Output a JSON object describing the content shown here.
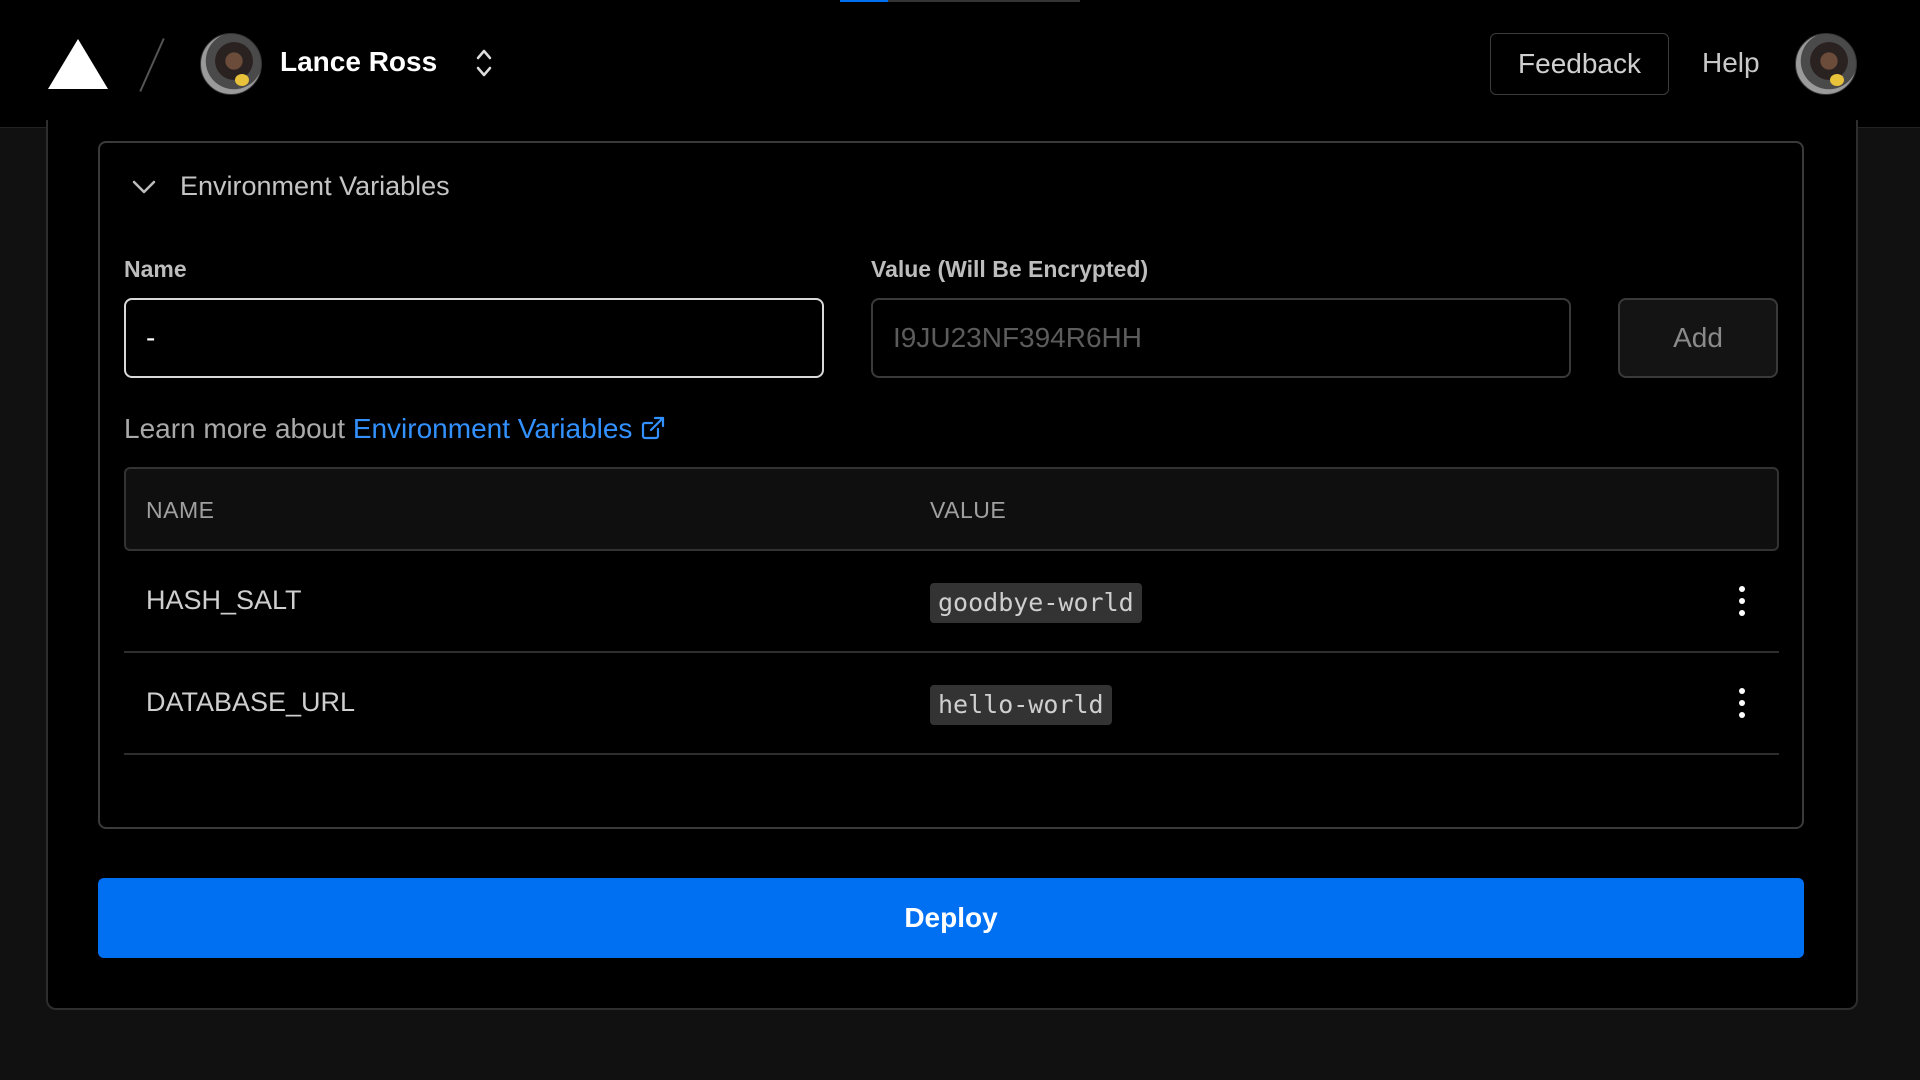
{
  "header": {
    "account_name": "Lance Ross",
    "feedback_label": "Feedback",
    "help_label": "Help"
  },
  "env": {
    "section_title": "Environment Variables",
    "name_label": "Name",
    "value_label": "Value (Will Be Encrypted)",
    "name_input_value": "-",
    "value_placeholder": "I9JU23NF394R6HH",
    "add_label": "Add",
    "learn_prefix": "Learn more about ",
    "learn_link": "Environment Variables",
    "table": {
      "headers": [
        "NAME",
        "VALUE"
      ],
      "rows": [
        {
          "name": "HASH_SALT",
          "value": "goodbye-world"
        },
        {
          "name": "DATABASE_URL",
          "value": "hello-world"
        }
      ]
    }
  },
  "deploy_label": "Deploy",
  "colors": {
    "accent": "#0070f3",
    "link": "#3291ff",
    "background": "#000000"
  },
  "icons": [
    "vercel-logo-icon",
    "chevron-up-down-icon",
    "chevron-down-icon",
    "external-link-icon",
    "more-vertical-icon"
  ]
}
